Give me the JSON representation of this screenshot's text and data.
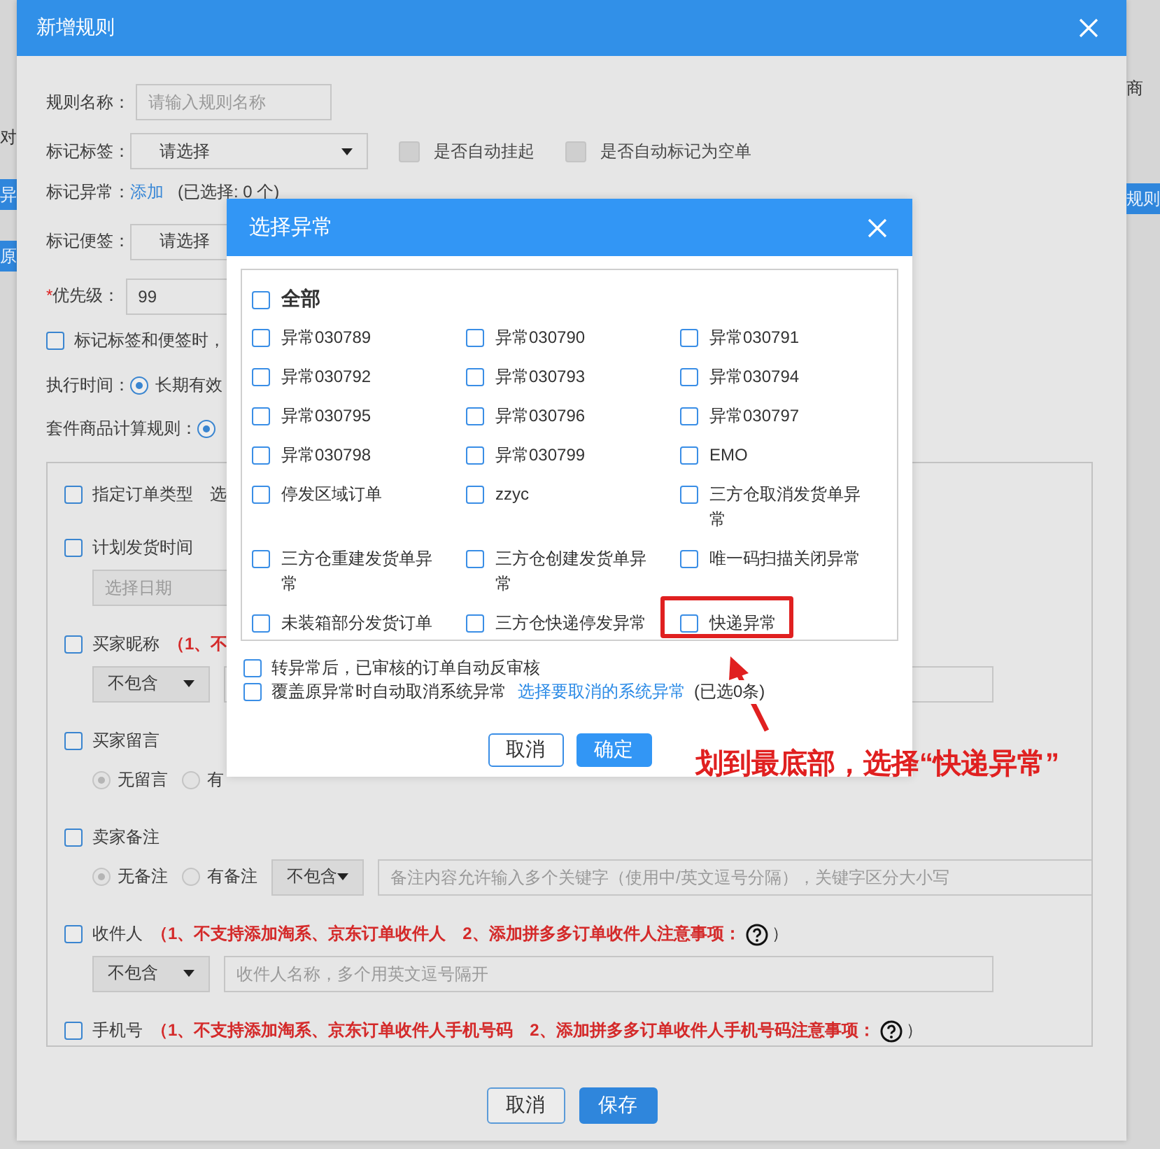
{
  "page": {
    "left_edge": [
      {
        "kind": "text",
        "text": "对"
      },
      {
        "kind": "button",
        "text": "异"
      },
      {
        "kind": "button",
        "text": "原"
      }
    ],
    "right_edge": [
      {
        "kind": "text",
        "text": "商"
      },
      {
        "kind": "button",
        "text": "规则"
      }
    ]
  },
  "dialog": {
    "title": "新增规则",
    "name_field": {
      "label": "规则名称：",
      "placeholder": "请输入规则名称"
    },
    "tag_field": {
      "label": "标记标签：",
      "value": "请选择",
      "options": [
        {
          "label": "是否自动挂起",
          "checked": false,
          "disabled": true
        },
        {
          "label": "是否自动标记为空单",
          "checked": false,
          "disabled": true
        }
      ]
    },
    "exception_field": {
      "label": "标记异常：",
      "link": "添加",
      "count": "(已选择: 0 个)"
    },
    "note_field": {
      "label": "标记便签：",
      "value": "请选择"
    },
    "priority_field": {
      "required_mark": "*",
      "label": "优先级：",
      "value": "99"
    },
    "sync_option": {
      "label": "标记标签和便签时，",
      "checked": false
    },
    "exec_time": {
      "label": "执行时间：",
      "options": [
        {
          "label": "长期有效",
          "selected": true
        }
      ]
    },
    "kit_rule": {
      "label": "套件商品计算规则：",
      "options": [
        {
          "selected": true
        }
      ]
    },
    "conditions": [
      {
        "label": "指定订单类型",
        "checked": false,
        "extra": "选"
      },
      {
        "label": "计划发货时间",
        "checked": false,
        "controls": [
          {
            "kind": "input",
            "placeholder": "选择日期"
          }
        ]
      },
      {
        "label": "买家昵称",
        "checked": false,
        "note": "（1、不",
        "controls": [
          {
            "kind": "select",
            "value": "不包含"
          },
          {
            "kind": "input"
          }
        ]
      },
      {
        "label": "买家留言",
        "checked": false,
        "controls": [
          {
            "kind": "radio",
            "label": "无留言",
            "selected": true,
            "disabled": true
          },
          {
            "kind": "radio",
            "label": "有",
            "selected": false,
            "disabled": true
          }
        ]
      },
      {
        "label": "卖家备注",
        "checked": false,
        "controls": [
          {
            "kind": "radio",
            "label": "无备注",
            "selected": true,
            "disabled": true
          },
          {
            "kind": "radio",
            "label": "有备注",
            "selected": false,
            "disabled": true
          },
          {
            "kind": "select",
            "value": "不包含"
          },
          {
            "kind": "input",
            "placeholder": "备注内容允许输入多个关键字（使用中/英文逗号分隔），关键字区分大小写"
          }
        ]
      },
      {
        "label": "收件人",
        "checked": false,
        "note": "（1、不支持添加淘系、京东订单收件人　2、添加拼多多订单收件人注意事项：",
        "help": true,
        "note_close": "）",
        "controls": [
          {
            "kind": "select",
            "value": "不包含"
          },
          {
            "kind": "input",
            "placeholder": "收件人名称，多个用英文逗号隔开"
          }
        ]
      },
      {
        "label": "手机号",
        "checked": false,
        "note": "（1、不支持添加淘系、京东订单收件人手机号码　2、添加拼多多订单收件人手机号码注意事项：",
        "help": true,
        "note_close": "）"
      }
    ],
    "buttons": [
      {
        "label": "取消",
        "primary": false
      },
      {
        "label": "保存",
        "primary": true
      }
    ]
  },
  "picker": {
    "title": "选择异常",
    "all": {
      "label": "全部",
      "checked": false
    },
    "items": [
      {
        "label": "异常030789",
        "checked": false
      },
      {
        "label": "异常030790",
        "checked": false
      },
      {
        "label": "异常030791",
        "checked": false
      },
      {
        "label": "异常030792",
        "checked": false
      },
      {
        "label": "异常030793",
        "checked": false
      },
      {
        "label": "异常030794",
        "checked": false
      },
      {
        "label": "异常030795",
        "checked": false
      },
      {
        "label": "异常030796",
        "checked": false
      },
      {
        "label": "异常030797",
        "checked": false
      },
      {
        "label": "异常030798",
        "checked": false
      },
      {
        "label": "异常030799",
        "checked": false
      },
      {
        "label": "EMO",
        "checked": false
      },
      {
        "label": "停发区域订单",
        "checked": false
      },
      {
        "label": "zzyc",
        "checked": false
      },
      {
        "label": "三方仓取消发货单异常",
        "checked": false
      },
      {
        "label": "三方仓重建发货单异常",
        "checked": false
      },
      {
        "label": "三方仓创建发货单异常",
        "checked": false
      },
      {
        "label": "唯一码扫描关闭异常",
        "checked": false
      },
      {
        "label": "未装箱部分发货订单",
        "checked": false
      },
      {
        "label": "三方仓快递停发异常",
        "checked": false
      },
      {
        "label": "快递异常",
        "checked": false,
        "highlighted": true
      }
    ],
    "options": [
      {
        "label": "转异常后，已审核的订单自动反审核",
        "checked": false
      },
      {
        "label": "覆盖原异常时自动取消系统异常",
        "checked": false,
        "link": "选择要取消的系统异常",
        "count": "(已选0条)"
      }
    ],
    "buttons": [
      {
        "label": "取消",
        "primary": false
      },
      {
        "label": "确定",
        "primary": true
      }
    ]
  },
  "annotation": {
    "text": "划到最底部，选择“快递异常”"
  }
}
